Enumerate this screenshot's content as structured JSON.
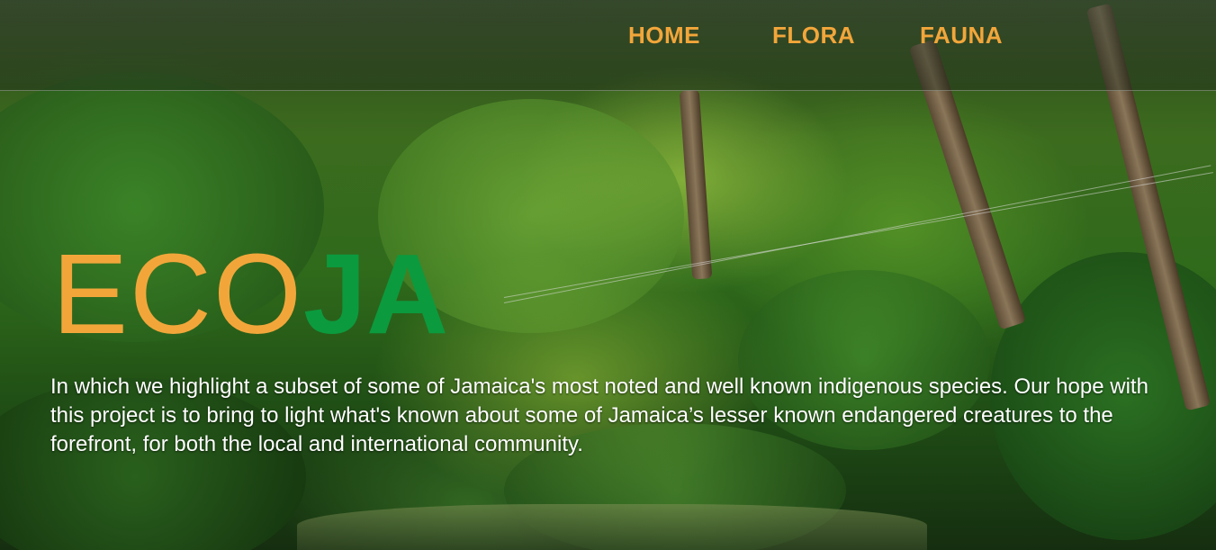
{
  "nav": {
    "home": "HOME",
    "flora": "FLORA",
    "fauna": "FAUNA"
  },
  "hero": {
    "title_part1": "ECO",
    "title_part2": "JA",
    "description": "In which we highlight a subset of some of Jamaica's most noted and well known indigenous species. Our hope with this project is to bring to light what's known about some of Jamaica’s lesser known endangered creatures to the forefront, for both the local and international community."
  },
  "colors": {
    "nav_text": "#f2a63a",
    "title_orange": "#f2a63a",
    "title_green": "#0c9a3e"
  }
}
